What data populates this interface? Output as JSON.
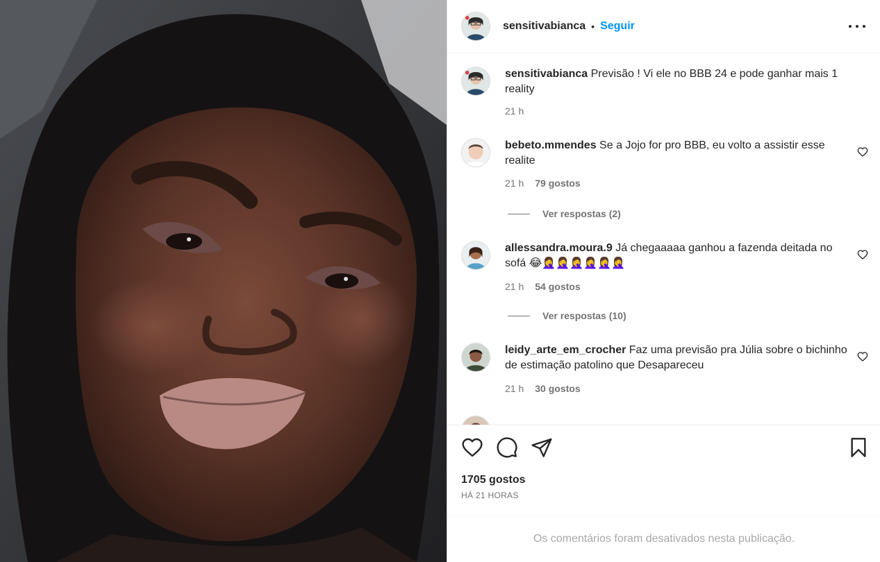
{
  "post": {
    "author": "sensitivabianca",
    "dot": "•",
    "follow_label": "Seguir",
    "caption_user": "sensitivabianca",
    "caption_text": "Previsão ! Vi ele no BBB 24 e pode ganhar mais 1 reality",
    "caption_time": "21 h"
  },
  "comments": [
    {
      "user": "bebeto.mmendes",
      "text": "Se a Jojo for pro BBB, eu volto a assistir esse realite",
      "time": "21 h",
      "likes": "79 gostos",
      "replies": "Ver respostas (2)"
    },
    {
      "user": "allessandra.moura.9",
      "text": "Já chegaaaaa ganhou a fazenda deitada no sofá 😂🤦‍♀️🤦‍♀️🤦‍♀️🤦‍♀️🤦‍♀️🤦‍♀️",
      "time": "21 h",
      "likes": "54 gostos",
      "replies": "Ver respostas (10)"
    },
    {
      "user": "leidy_arte_em_crocher",
      "text": "Faz uma previsão pra Júlia sobre o bichinho de estimação patolino que Desapareceu",
      "time": "21 h",
      "likes": "30 gostos"
    }
  ],
  "footer": {
    "likes_total": "1705 gostos",
    "time_ago": "HÁ 21 HORAS",
    "comments_disabled": "Os comentários foram desativados nesta publicação."
  },
  "icons": {
    "like": "heart-icon",
    "comment": "comment-icon",
    "share": "share-icon",
    "save": "bookmark-icon",
    "more": "more-options-icon"
  }
}
